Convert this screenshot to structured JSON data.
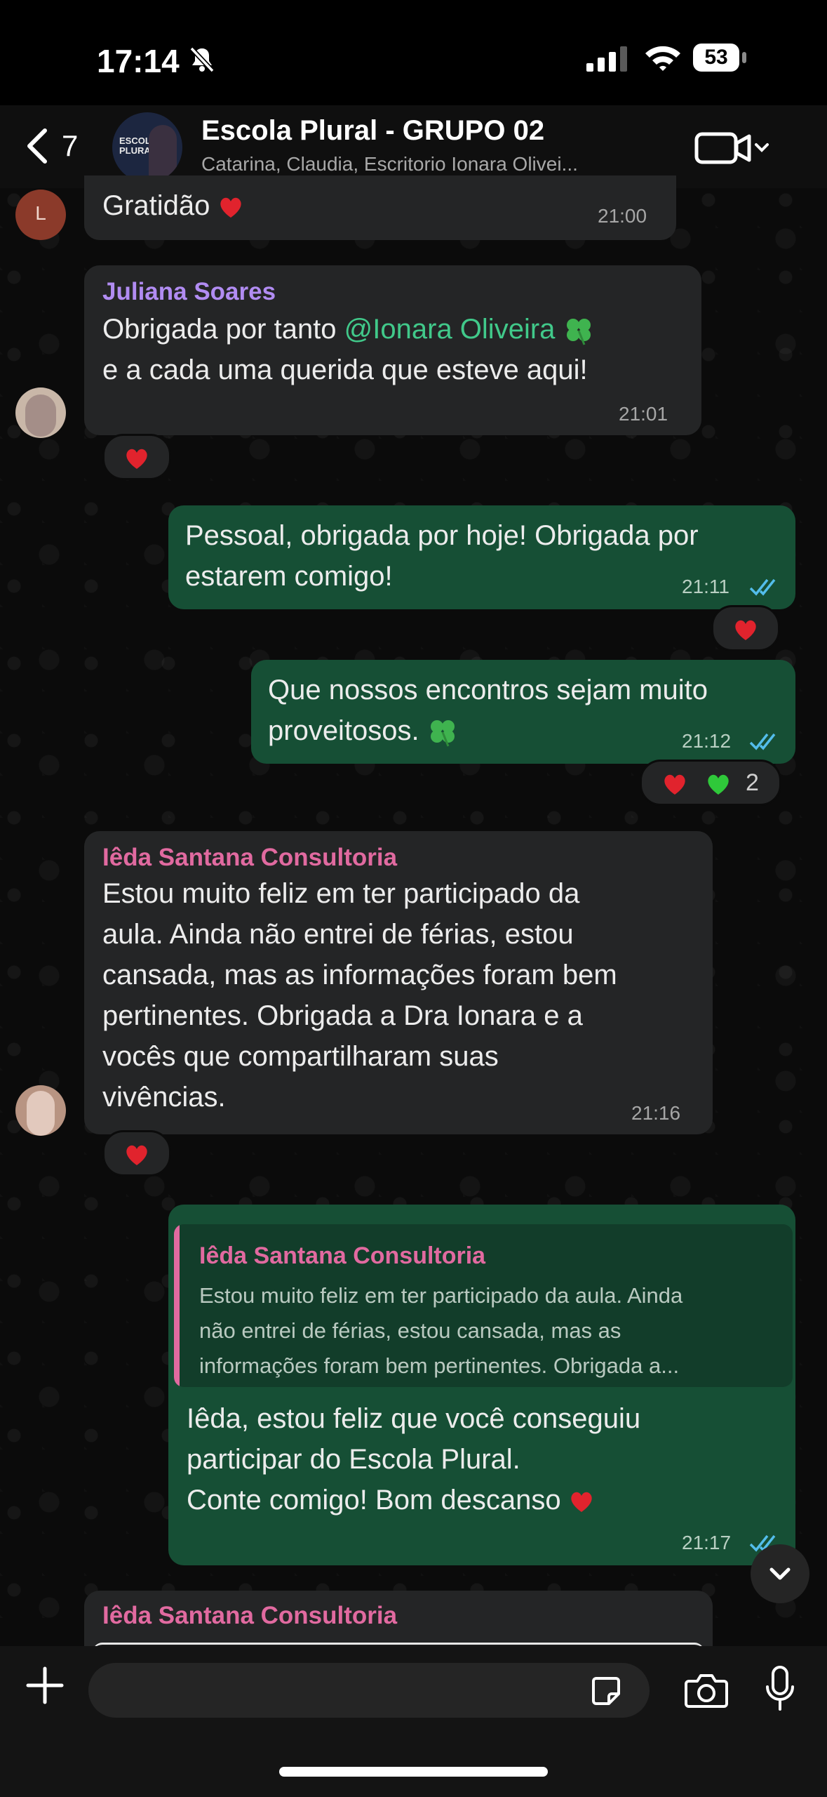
{
  "status_bar": {
    "time": "17:14",
    "battery": "53"
  },
  "header": {
    "back_count": "7",
    "group_avatar_text": "ESCOLA PLURAL",
    "title": "Escola Plural  - GRUPO 02",
    "subtitle": "Catarina, Claudia, Escritorio Ionara Olivei..."
  },
  "messages": [
    {
      "text": "Gratidão",
      "time": "21:00",
      "avatar_initial": "L"
    },
    {
      "sender": "Juliana Soares",
      "sender_color": "#b18cf2",
      "line1_prefix": "Obrigada por tanto ",
      "mention": "@Ionara Oliveira",
      "line2": "e a cada uma querida que esteve aqui!",
      "time": "21:01"
    },
    {
      "line1": "Pessoal, obrigada por hoje! Obrigada por",
      "line2": "estarem comigo!",
      "time": "21:11"
    },
    {
      "line1": "Que nossos encontros sejam muito",
      "line2": "proveitosos.",
      "time": "21:12",
      "reaction_count": "2"
    },
    {
      "sender": "Iêda Santana Consultoria",
      "sender_color": "#e16aa0",
      "lines": [
        "Estou muito feliz em ter participado da",
        "aula. Ainda não entrei de férias, estou",
        "cansada, mas as informações foram bem",
        "pertinentes. Obrigada a Dra Ionara e a",
        "vocês que compartilharam suas",
        "vivências."
      ],
      "time": "21:16"
    },
    {
      "quote_name": "Iêda Santana Consultoria",
      "quote_lines": [
        "Estou muito feliz em ter participado da aula. Ainda",
        "não entrei de férias, estou cansada, mas as",
        "informações foram bem pertinentes. Obrigada a..."
      ],
      "lines": [
        "Iêda, estou feliz que você conseguiu",
        "participar do Escola Plural.",
        "Conte comigo! Bom descanso"
      ],
      "time": "21:17"
    },
    {
      "sender": "Iêda Santana Consultoria"
    }
  ],
  "composer": {
    "placeholder": ""
  },
  "colors": {
    "outgoing": "#164f35",
    "incoming": "#242526",
    "mention": "#41c98a",
    "tick": "#53bdeb"
  }
}
